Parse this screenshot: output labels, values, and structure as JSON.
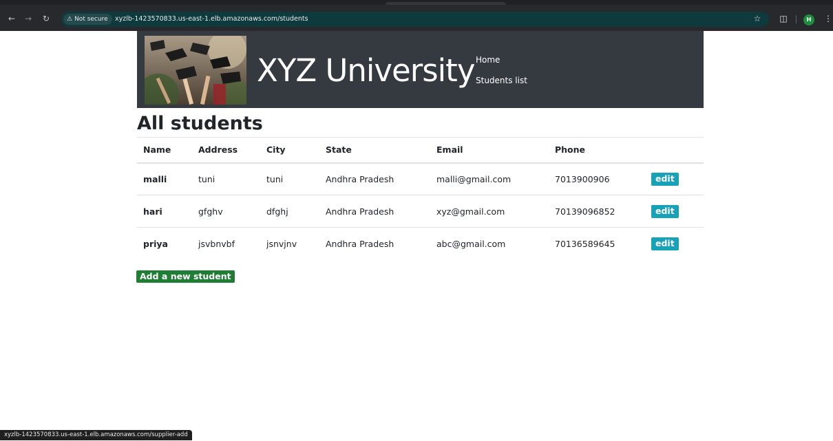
{
  "browser": {
    "security_label": "Not secure",
    "url": "xyzlb-1423570833.us-east-1.elb.amazonaws.com/students",
    "profile_initial": "H",
    "status_url": "xyzlb-1423570833.us-east-1.elb.amazonaws.com/supplier-add"
  },
  "header": {
    "title": "XYZ University",
    "nav": [
      "Home",
      "Students list"
    ]
  },
  "page": {
    "title": "All students"
  },
  "table": {
    "columns": [
      "Name",
      "Address",
      "City",
      "State",
      "Email",
      "Phone",
      ""
    ],
    "rows": [
      {
        "name": "malli",
        "address": "tuni",
        "city": "tuni",
        "state": "Andhra Pradesh",
        "email": "malli@gmail.com",
        "phone": "7013900906",
        "action": "edit"
      },
      {
        "name": "hari",
        "address": "gfghv",
        "city": "dfghj",
        "state": "Andhra Pradesh",
        "email": "xyz@gmail.com",
        "phone": "70139096852",
        "action": "edit"
      },
      {
        "name": "priya",
        "address": "jsvbnvbf",
        "city": "jsnvjnv",
        "state": "Andhra Pradesh",
        "email": "abc@gmail.com",
        "phone": "70136589645",
        "action": "edit"
      }
    ]
  },
  "actions": {
    "add_label": "Add a new student"
  },
  "colors": {
    "header_bg": "#343a40",
    "edit_button": "#17a2b8",
    "add_button": "#1e7e34",
    "omnibox_bg": "#0e3a3d"
  },
  "icons": [
    "back-arrow-icon",
    "forward-arrow-icon",
    "reload-icon",
    "warning-icon",
    "star-icon",
    "extensions-icon",
    "kebab-menu-icon"
  ]
}
